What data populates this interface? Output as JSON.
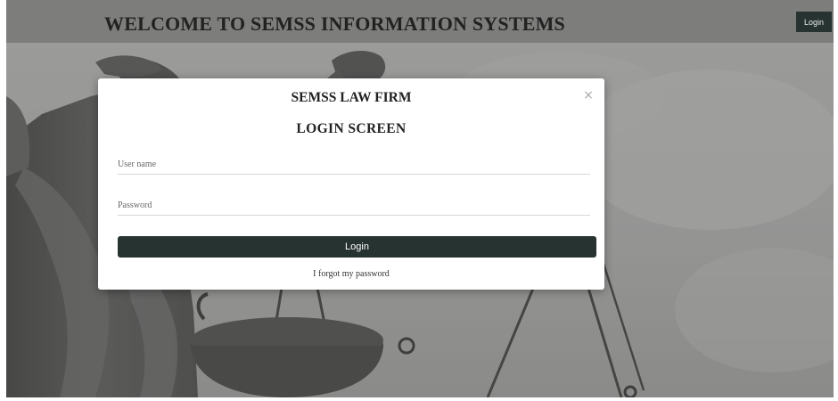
{
  "header": {
    "title": "WELCOME TO SEMSS INFORMATION SYSTEMS",
    "login_label": "Login"
  },
  "modal": {
    "title": "SEMSS LAW FIRM",
    "subtitle": "LOGIN SCREEN",
    "close_glyph": "×",
    "username_placeholder": "User name",
    "password_placeholder": "Password",
    "login_label": "Login",
    "forgot_label": "I forgot my password"
  },
  "colors": {
    "header_bg": "#7d7d7c",
    "button_bg": "#263331",
    "page_bg": "#9a9a98"
  },
  "icons": [
    "close-icon",
    "lady-justice-background-image"
  ]
}
